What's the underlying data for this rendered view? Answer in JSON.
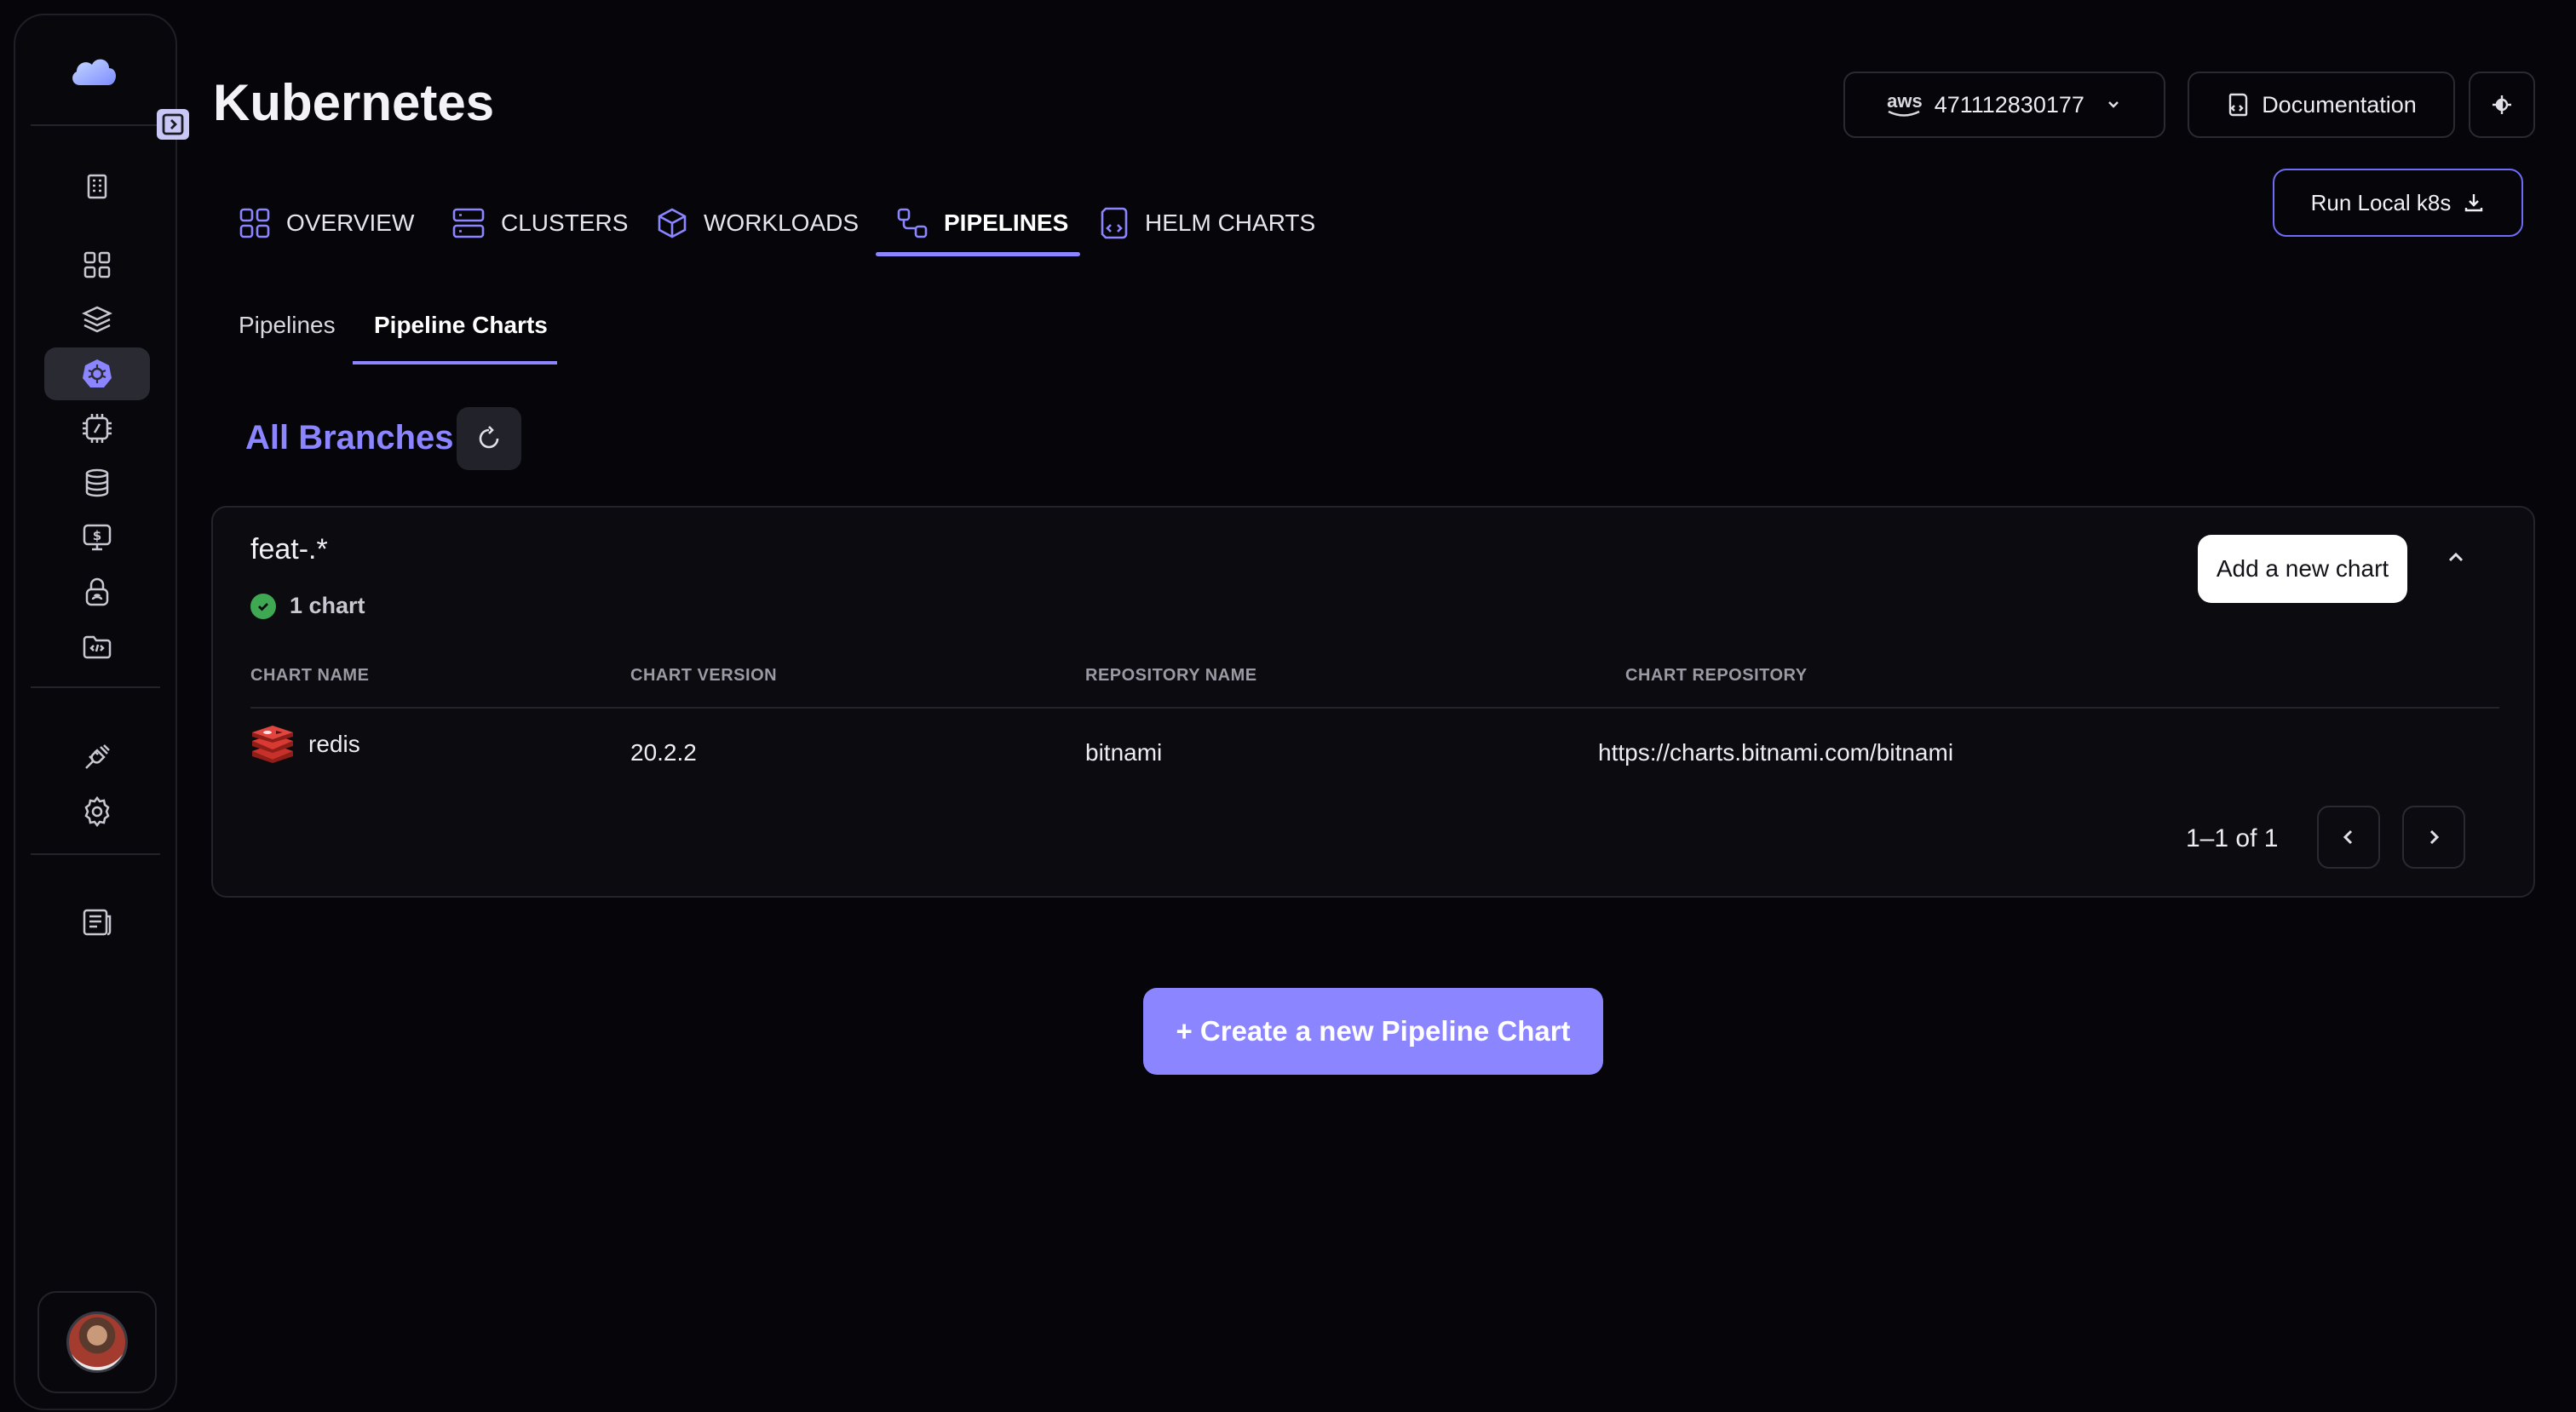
{
  "colors": {
    "accent": "#8b85ff",
    "background": "#06060a",
    "success": "#3fa853",
    "card": "#0c0c10"
  },
  "sidebar": {
    "items": [
      {
        "name": "building-icon"
      },
      {
        "name": "grid-icon"
      },
      {
        "name": "layers-icon"
      },
      {
        "name": "kubernetes-icon",
        "active": true
      },
      {
        "name": "chip-icon"
      },
      {
        "name": "database-icon"
      },
      {
        "name": "cost-icon"
      },
      {
        "name": "lock-icon"
      },
      {
        "name": "code-folder-icon"
      },
      {
        "name": "plug-icon"
      },
      {
        "name": "gear-icon"
      },
      {
        "name": "document-icon"
      }
    ]
  },
  "header": {
    "title": "Kubernetes",
    "aws_logo": "aws",
    "account_id": "471112830177",
    "documentation_label": "Documentation",
    "run_local_label": "Run Local k8s"
  },
  "tabs": [
    {
      "label": "OVERVIEW",
      "icon": "grid-icon"
    },
    {
      "label": "CLUSTERS",
      "icon": "server-icon"
    },
    {
      "label": "WORKLOADS",
      "icon": "cube-icon"
    },
    {
      "label": "PIPELINES",
      "icon": "pipeline-icon",
      "active": true
    },
    {
      "label": "HELM CHARTS",
      "icon": "helm-icon"
    }
  ],
  "subtabs": [
    {
      "label": "Pipelines"
    },
    {
      "label": "Pipeline Charts",
      "active": true
    }
  ],
  "branches_title": "All Branches",
  "card": {
    "title": "feat-.*",
    "count_label": "1 chart",
    "add_chart_label": "Add a new chart",
    "columns": [
      "CHART NAME",
      "CHART VERSION",
      "REPOSITORY NAME",
      "CHART REPOSITORY"
    ],
    "rows": [
      {
        "name": "redis",
        "version": "20.2.2",
        "repo_name": "bitnami",
        "repo_url": "https://charts.bitnami.com/bitnami"
      }
    ],
    "pagination": "1–1 of 1"
  },
  "create_button_label": "+ Create a new Pipeline Chart"
}
